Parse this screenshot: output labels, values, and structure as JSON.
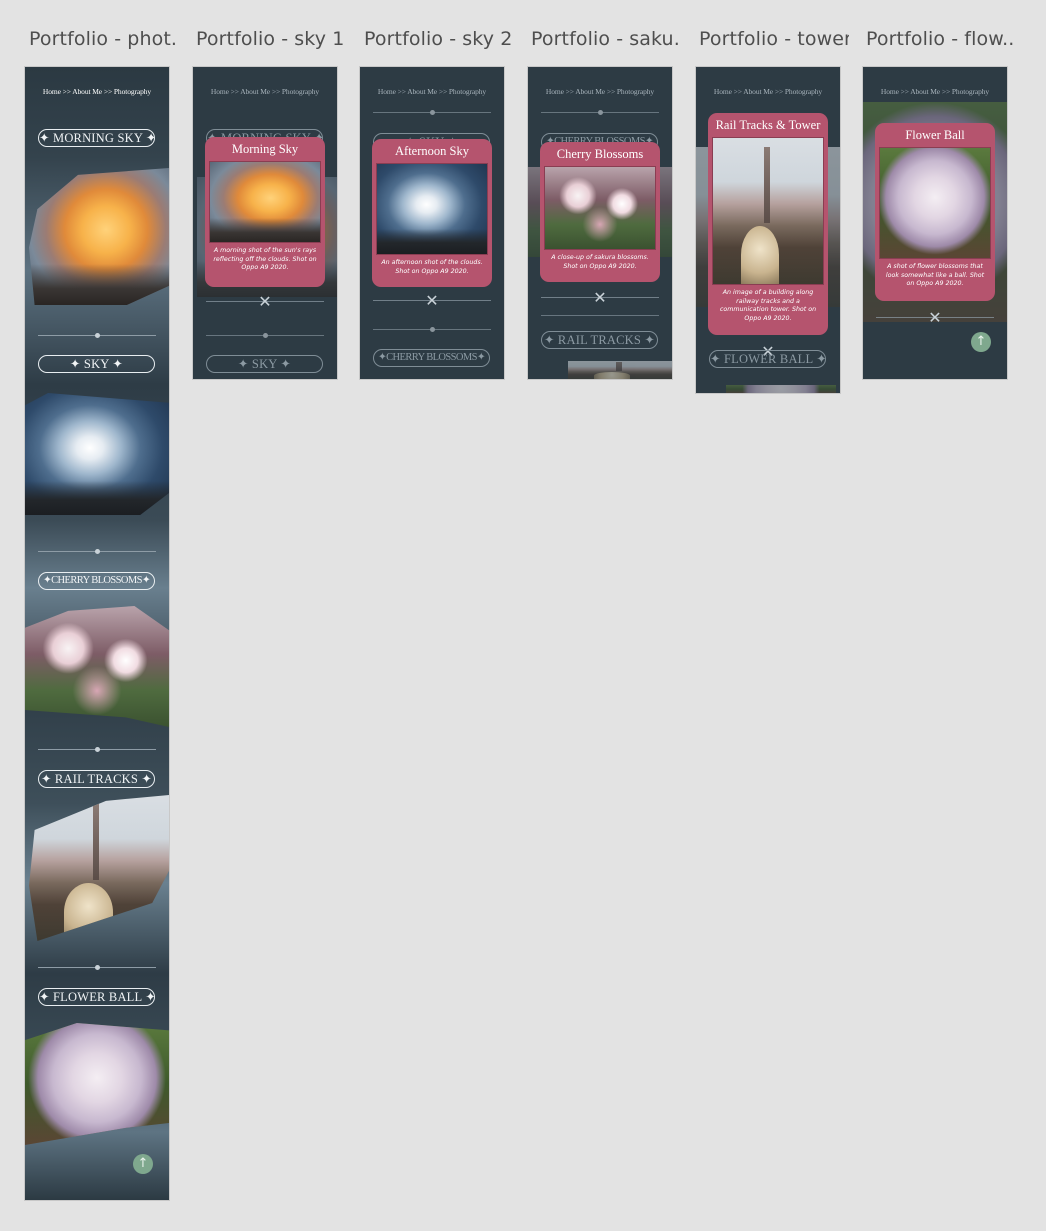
{
  "artboards": [
    {
      "title": "Portfolio - phot..."
    },
    {
      "title": "Portfolio - sky 1"
    },
    {
      "title": "Portfolio - sky 2"
    },
    {
      "title": "Portfolio - saku..."
    },
    {
      "title": "Portfolio - tower"
    },
    {
      "title": "Portfolio - flow..."
    }
  ],
  "breadcrumb": "Home  >>  About Me  >>  Photography",
  "sections": {
    "morning": "✦ MORNING SKY ✦",
    "sky": "✦ SKY ✦",
    "cherry": "✦CHERRY BLOSSOMS✦",
    "rail": "✦ RAIL TRACKS ✦",
    "flower": "✦ FLOWER BALL ✦"
  },
  "cards": {
    "morning": {
      "title": "Morning Sky",
      "caption": "A morning shot of the sun's rays reflecting off the clouds. Shot on Oppo A9 2020."
    },
    "afternoon": {
      "title": "Afternoon Sky",
      "caption": "An afternoon shot of the clouds. Shot on Oppo A9 2020."
    },
    "cherry": {
      "title": "Cherry Blossoms",
      "caption": "A close-up of sakura blossoms. Shot on Oppo A9 2020."
    },
    "tower": {
      "title": "Rail Tracks & Tower",
      "caption": "An image of a building along railway tracks and a communication tower. Shot on Oppo A9 2020."
    },
    "flower": {
      "title": "Flower Ball",
      "caption": "A shot of flower blossoms that look somewhat like a ball. Shot on Oppo A9 2020."
    }
  },
  "icons": {
    "up": "↑",
    "cross": "✕"
  },
  "colors": {
    "page_bg": "#e3e3e3",
    "frame_bg": "#2d3b44",
    "card": "#b5546e",
    "up_button": "#7fa88e"
  }
}
